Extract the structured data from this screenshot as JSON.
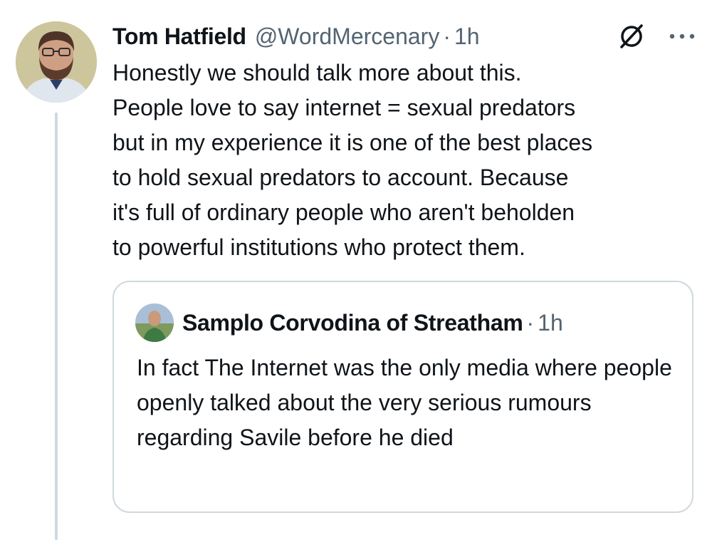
{
  "tweet": {
    "author_name": "Tom Hatfield",
    "handle": "@WordMercenary",
    "separator": "·",
    "time": "1h",
    "icons": [
      "grok-icon",
      "more-icon"
    ],
    "text": "Honestly we should talk more about this.\nPeople love to say internet = sexual predators\nbut in my experience it is one of the best places\nto hold sexual predators to account. Because\nit's full of ordinary people who aren't beholden\nto powerful institutions who protect them."
  },
  "quote": {
    "author_name": "Samplo Corvodina of Streatham",
    "separator": "·",
    "time": "1h",
    "text": "In fact The Internet was the only media where people openly talked about the very serious rumours regarding Savile before he died"
  },
  "colors": {
    "text": "#0f1419",
    "secondary": "#536471",
    "border": "#cfd9de"
  }
}
